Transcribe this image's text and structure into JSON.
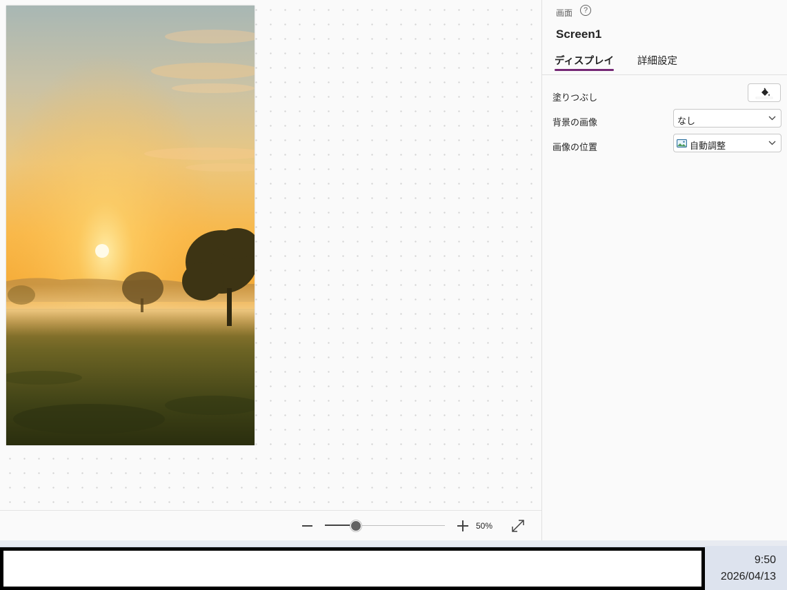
{
  "canvas": {
    "screen_image": "sunrise-meadow-photo"
  },
  "zoom": {
    "value_label": "50%",
    "level_fraction": 0.25
  },
  "panel": {
    "kind": "画面",
    "help_icon": "question-circle-icon",
    "screen_name": "Screen1",
    "tabs": [
      {
        "label": "ディスプレイ",
        "active": true
      },
      {
        "label": "詳細設定",
        "active": false
      }
    ],
    "properties": {
      "fill_label": "塗りつぶし",
      "fill_icon": "paint-bucket-icon",
      "background_image_label": "背景の画像",
      "background_image_value": "なし",
      "image_position_label": "画像の位置",
      "image_position_value": "自動調整",
      "image_position_icon": "image-icon"
    }
  },
  "taskbar": {
    "time": "9:50",
    "date": "2026/04/13"
  },
  "colors": {
    "accent": "#742774",
    "canvas_bg": "#fafafa",
    "taskbar_bg": "#dde3ee"
  }
}
